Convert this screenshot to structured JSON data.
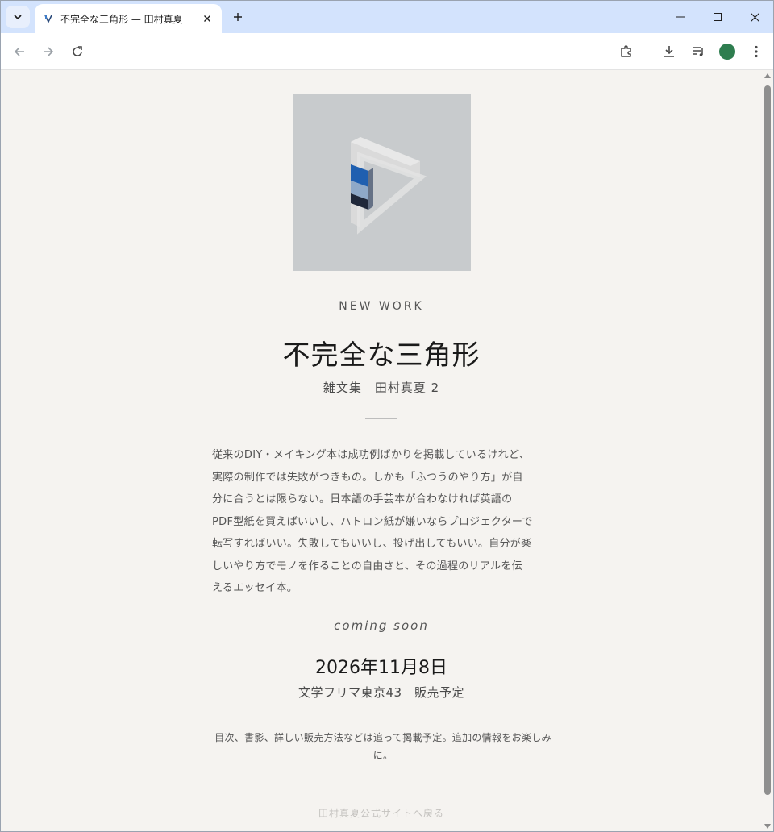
{
  "browser": {
    "tab": {
      "title": "不完全な三角形 — 田村真夏"
    },
    "colors": {
      "tab_strip": "#d3e3fd",
      "avatar": "#2e7d4f"
    }
  },
  "page": {
    "eyebrow": "NEW WORK",
    "title": "不完全な三角形",
    "subtitle": "雑文集　田村真夏 2",
    "description": [
      "従来のDIY・メイキング本は成功例ばかりを掲載しているけれど、",
      "実際の制作では失敗がつきもの。しかも「ふつうのやり方」が自",
      "分に合うとは限らない。日本語の手芸本が合わなければ英語の",
      "PDF型紙を買えばいいし、ハトロン紙が嫌いならプロジェクターで",
      "転写すればいい。失敗してもいいし、投げ出してもいい。自分が楽",
      "しいやり方でモノを作ることの自由さと、その過程のリアルを伝",
      "えるエッセイ本。"
    ],
    "coming_soon": "coming soon",
    "release_date": "2026年11月8日",
    "event": "文学フリマ東京43　販売予定",
    "note": "目次、書影、詳しい販売方法などは追って掲載予定。追加の情報をお楽しみに。",
    "back_link": "田村真夏公式サイトへ戻る",
    "colors": {
      "background": "#f5f3f0",
      "cover_bg": "#c8cbcd"
    }
  }
}
